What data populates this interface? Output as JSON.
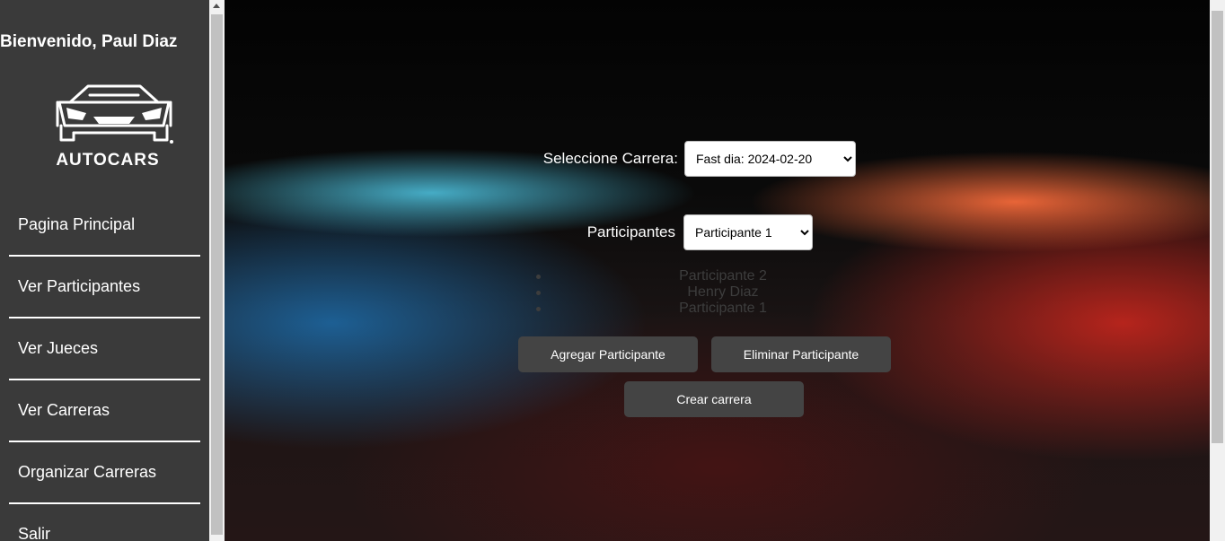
{
  "sidebar": {
    "welcome": "Bienvenido, Paul Diaz",
    "logo_text": "AUTOCARS",
    "nav": [
      {
        "label": "Pagina Principal"
      },
      {
        "label": "Ver Participantes"
      },
      {
        "label": "Ver Jueces"
      },
      {
        "label": "Ver Carreras"
      },
      {
        "label": "Organizar Carreras"
      },
      {
        "label": "Salir"
      }
    ]
  },
  "form": {
    "race_label": "Seleccione Carrera:",
    "race_selected": "Fast dia: 2024-02-20",
    "participants_label": "Participantes",
    "participant_selected": "Participante 1",
    "participants_list": [
      "Participante 2",
      "Henry Diaz",
      "Participante 1"
    ],
    "add_button": "Agregar Participante",
    "remove_button": "Eliminar Participante",
    "create_button": "Crear carrera"
  }
}
